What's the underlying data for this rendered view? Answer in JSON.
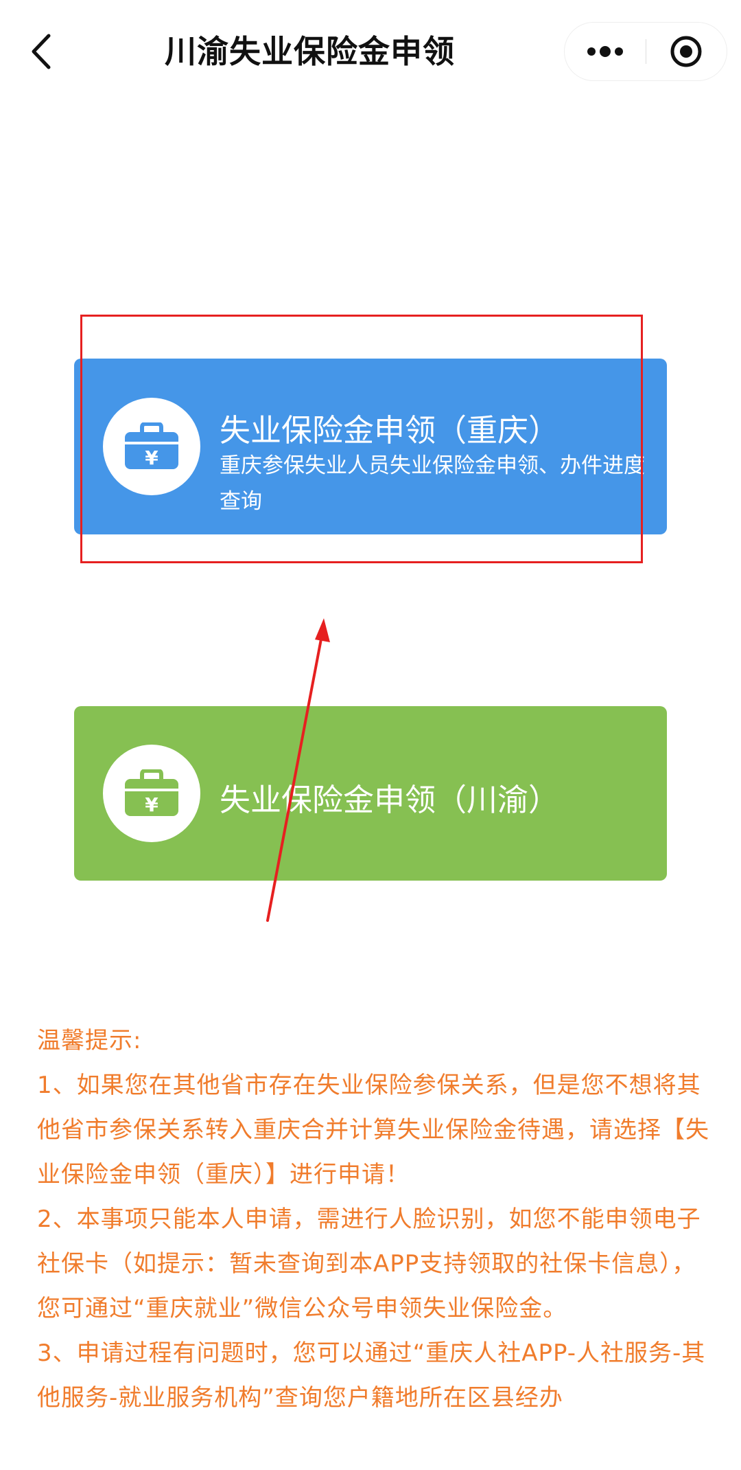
{
  "header": {
    "title": "川渝失业保险金申领",
    "back_icon": "chevron-left-icon",
    "more_icon": "more-dots-icon",
    "close_icon": "mini-program-close-icon"
  },
  "cards": [
    {
      "id": "chongqing",
      "title": "失业保险金申领（重庆）",
      "description": "重庆参保失业人员失业保险金申领、办件进度查询",
      "color": "#4596e8",
      "icon": "money-bag-icon"
    },
    {
      "id": "chuanyu",
      "title": "失业保险金申领（川渝）",
      "color": "#86c052",
      "icon": "money-bag-icon"
    }
  ],
  "tips": {
    "heading": "温馨提示:",
    "items": [
      "1、如果您在其他省市存在失业保险参保关系，但是您不想将其他省市参保关系转入重庆合并计算失业保险金待遇，请选择【失业保险金申领（重庆）】进行申请！",
      "2、本事项只能本人申请，需进行人脸识别，如您不能申领电子社保卡（如提示：暂未查询到本APP支持领取的社保卡信息），您可通过“重庆就业”微信公众号申领失业保险金。",
      "3、申请过程有问题时，您可以通过“重庆人社APP-人社服务-其他服务-就业服务机构”查询您户籍地所在区县经办"
    ],
    "color": "#f07c2c"
  },
  "annotation": {
    "color": "#e62020"
  }
}
